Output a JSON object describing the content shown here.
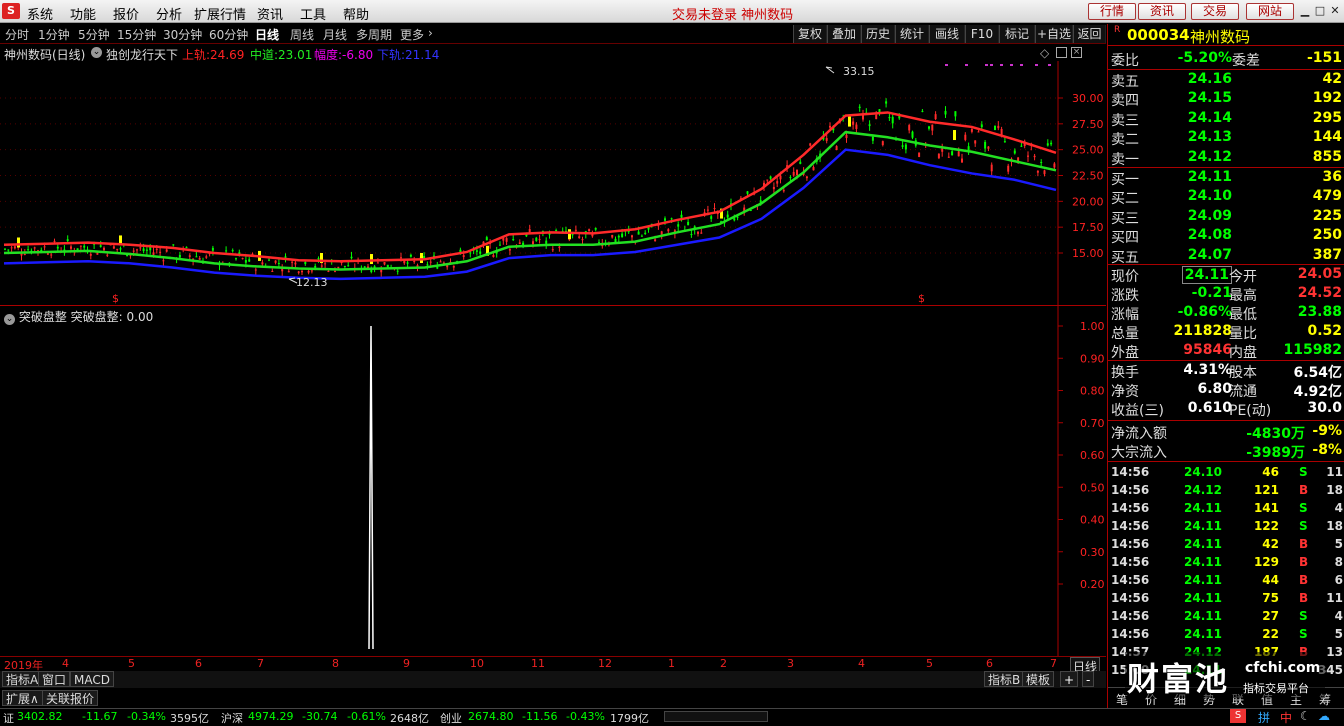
{
  "menu": {
    "items": [
      "系统",
      "功能",
      "报价",
      "分析",
      "扩展行情",
      "资讯",
      "工具",
      "帮助"
    ],
    "status": "交易未登录 神州数码",
    "buttons": [
      "行情",
      "资讯",
      "交易",
      "网站"
    ]
  },
  "timeframes": [
    "分时",
    "1分钟",
    "5分钟",
    "15分钟",
    "30分钟",
    "60分钟",
    "日线",
    "周线",
    "月线",
    "多周期",
    "更多"
  ],
  "tools": [
    "复权",
    "叠加",
    "历史",
    "统计",
    "画线",
    "F10",
    "标记",
    "+自选",
    "返回"
  ],
  "chart_head": {
    "name": "神州数码(日线)",
    "indicator": "独创龙行天下",
    "upper_label": "上轨:",
    "upper_val": "24.69",
    "mid_label": "中道:",
    "mid_val": "23.01",
    "width_label": "幅度:",
    "width_val": "-6.80",
    "lower_label": "下轨:",
    "lower_val": "21.14"
  },
  "sub_head": {
    "name": "突破盘整",
    "label": "突破盘整:",
    "val": "0.00"
  },
  "chart_data": [
    {
      "type": "line",
      "title": "神州数码(日线)",
      "y_ticks": [
        15.0,
        17.5,
        20.0,
        22.5,
        25.0,
        27.5,
        30.0
      ],
      "annotations": [
        "33.15",
        "12.13"
      ],
      "x_labels": [
        "2019年",
        "4",
        "5",
        "6",
        "7",
        "8",
        "9",
        "10",
        "11",
        "12",
        "1",
        "2",
        "3",
        "4",
        "5",
        "6",
        "7"
      ],
      "series": [
        {
          "name": "上轨",
          "color": "#ff2a2a",
          "values": [
            15.8,
            15.9,
            16.0,
            15.8,
            15.5,
            15.0,
            14.7,
            14.3,
            14.2,
            14.3,
            14.4,
            15.1,
            16.8,
            17.0,
            16.9,
            17.3,
            18.2,
            19.0,
            21.2,
            24.5,
            28.3,
            28.6,
            27.7,
            27.2,
            26.0,
            24.7
          ]
        },
        {
          "name": "中道",
          "color": "#22e022",
          "values": [
            15.0,
            15.1,
            15.2,
            14.9,
            14.5,
            14.0,
            13.7,
            13.5,
            13.4,
            13.5,
            13.6,
            14.2,
            15.6,
            15.8,
            15.8,
            16.1,
            17.0,
            17.8,
            19.8,
            22.8,
            26.7,
            26.2,
            25.4,
            24.8,
            23.9,
            23.0
          ]
        },
        {
          "name": "下轨",
          "color": "#1a1aff",
          "values": [
            14.0,
            14.1,
            14.2,
            14.0,
            13.6,
            13.1,
            12.8,
            12.6,
            12.5,
            12.6,
            12.7,
            13.2,
            14.5,
            14.8,
            14.8,
            15.1,
            15.8,
            16.5,
            18.3,
            21.3,
            25.0,
            24.5,
            23.5,
            22.7,
            22.1,
            21.1
          ]
        }
      ]
    },
    {
      "type": "line",
      "title": "突破盘整",
      "y_ticks": [
        0.2,
        0.3,
        0.4,
        0.5,
        0.6,
        0.7,
        0.8,
        0.9,
        1.0
      ],
      "series": [
        {
          "name": "突破盘整",
          "values": [
            0,
            1,
            0
          ]
        }
      ]
    }
  ],
  "bottom_tabs": [
    "指标A",
    "窗口",
    "MACD"
  ],
  "bottom_tabs2": [
    "扩展∧",
    "关联报价"
  ],
  "bottom_right": [
    "指标B",
    "模板"
  ],
  "right_panel": {
    "code": "000034",
    "name": "神州数码",
    "weibi_label": "委比",
    "weibi": "-5.20%",
    "weicha_label": "委差",
    "weicha": "-151",
    "sells": [
      {
        "l": "卖五",
        "p": "24.16",
        "v": "42"
      },
      {
        "l": "卖四",
        "p": "24.15",
        "v": "192"
      },
      {
        "l": "卖三",
        "p": "24.14",
        "v": "295"
      },
      {
        "l": "卖二",
        "p": "24.13",
        "v": "144"
      },
      {
        "l": "卖一",
        "p": "24.12",
        "v": "855"
      }
    ],
    "buys": [
      {
        "l": "买一",
        "p": "24.11",
        "v": "36"
      },
      {
        "l": "买二",
        "p": "24.10",
        "v": "479"
      },
      {
        "l": "买三",
        "p": "24.09",
        "v": "225"
      },
      {
        "l": "买四",
        "p": "24.08",
        "v": "250"
      },
      {
        "l": "买五",
        "p": "24.07",
        "v": "387"
      }
    ],
    "quote": [
      {
        "l1": "现价",
        "v1": "24.11",
        "l2": "今开",
        "v2": "24.05"
      },
      {
        "l1": "涨跌",
        "v1": "-0.21",
        "l2": "最高",
        "v2": "24.52"
      },
      {
        "l1": "涨幅",
        "v1": "-0.86%",
        "l2": "最低",
        "v2": "23.88"
      },
      {
        "l1": "总量",
        "v1": "211828",
        "l2": "量比",
        "v2": "0.52"
      },
      {
        "l1": "外盘",
        "v1": "95846",
        "l2": "内盘",
        "v2": "115982"
      }
    ],
    "quote2": [
      {
        "l1": "换手",
        "v1": "4.31%",
        "l2": "股本",
        "v2": "6.54亿"
      },
      {
        "l1": "净资",
        "v1": "6.80",
        "l2": "流通",
        "v2": "4.92亿"
      },
      {
        "l1": "收益(三)",
        "v1": "0.610",
        "l2": "PE(动)",
        "v2": "30.0"
      }
    ],
    "flow": [
      {
        "l": "净流入额",
        "v": "-4830万",
        "p": "-9%"
      },
      {
        "l": "大宗流入",
        "v": "-3989万",
        "p": "-8%"
      }
    ],
    "ticks": [
      {
        "t": "14:56",
        "p": "24.10",
        "v": "46",
        "s": "S",
        "n": "11"
      },
      {
        "t": "14:56",
        "p": "24.12",
        "v": "121",
        "s": "B",
        "n": "18"
      },
      {
        "t": "14:56",
        "p": "24.11",
        "v": "141",
        "s": "S",
        "n": "4"
      },
      {
        "t": "14:56",
        "p": "24.11",
        "v": "122",
        "s": "S",
        "n": "18"
      },
      {
        "t": "14:56",
        "p": "24.11",
        "v": "42",
        "s": "B",
        "n": "5"
      },
      {
        "t": "14:56",
        "p": "24.11",
        "v": "129",
        "s": "B",
        "n": "8"
      },
      {
        "t": "14:56",
        "p": "24.11",
        "v": "44",
        "s": "B",
        "n": "6"
      },
      {
        "t": "14:56",
        "p": "24.11",
        "v": "75",
        "s": "B",
        "n": "11"
      },
      {
        "t": "14:56",
        "p": "24.11",
        "v": "27",
        "s": "S",
        "n": "4"
      },
      {
        "t": "14:56",
        "p": "24.11",
        "v": "22",
        "s": "S",
        "n": "5"
      },
      {
        "t": "14:57",
        "p": "24.12",
        "v": "187",
        "s": "B",
        "n": "13"
      },
      {
        "t": "15:00",
        "p": "24.11",
        "v": "",
        "s": "",
        "n": "345"
      }
    ],
    "bottom_tabs": [
      "笔",
      "价",
      "细",
      "势",
      "联",
      "值",
      "主",
      "筹"
    ]
  },
  "watermark": {
    "text": "财富池",
    "site": "cfchi.com",
    "sub": "指标交易平台"
  },
  "statusbar": {
    "sh_label": "证",
    "sh": "3402.82",
    "sh_chg": "-11.67",
    "sh_pct": "-0.34%",
    "sh_amt": "3595亿",
    "sz_label": "沪深",
    "sz": "4974.29",
    "sz_chg": "-30.74",
    "sz_pct": "-0.61%",
    "sz_amt": "2648亿",
    "cy_label": "创业",
    "cy": "2674.80",
    "cy_chg": "-11.56",
    "cy_pct": "-0.43%",
    "cy_amt": "1799亿"
  },
  "colors": {
    "up": "#ff2a2a",
    "down": "#00ff00",
    "mid": "#22e022",
    "low": "#1a1aff"
  }
}
